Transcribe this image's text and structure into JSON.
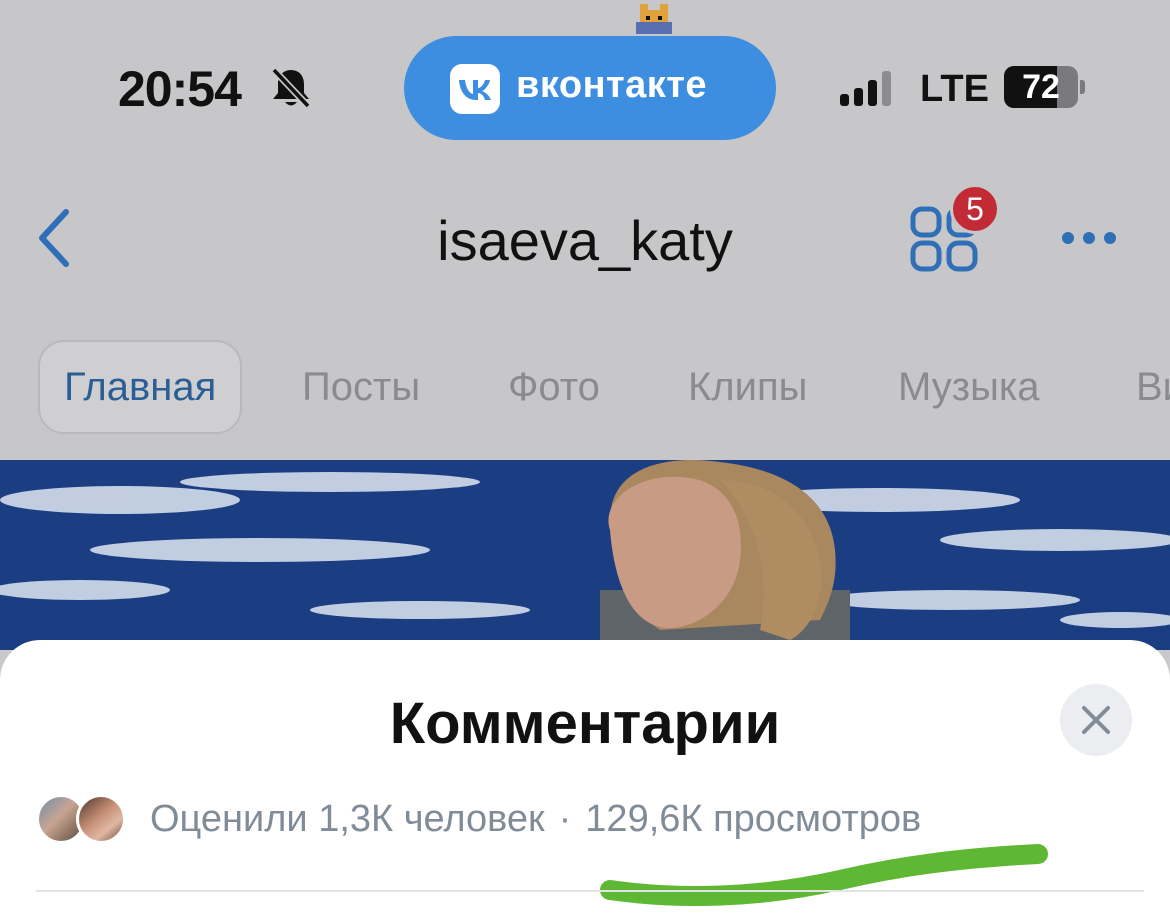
{
  "status_bar": {
    "time": "20:54",
    "network": "LTE",
    "battery": "72",
    "battery_level": 0.72
  },
  "app_pill": {
    "label": "вконтакте"
  },
  "profile": {
    "username": "isaeva_katy",
    "apps_badge": "5"
  },
  "tabs": [
    {
      "label": "Главная",
      "active": true
    },
    {
      "label": "Посты",
      "active": false
    },
    {
      "label": "Фото",
      "active": false
    },
    {
      "label": "Клипы",
      "active": false
    },
    {
      "label": "Музыка",
      "active": false
    },
    {
      "label": "Ви",
      "active": false
    }
  ],
  "comments_sheet": {
    "title": "Комментарии",
    "liked_text": "Оценили 1,3К человек",
    "separator": "·",
    "views_text": "129,6К просмотров"
  },
  "icons": {
    "bell": "bell-muted-icon",
    "back": "chevron-left-icon",
    "apps": "apps-grid-icon",
    "more": "more-horizontal-icon",
    "close": "close-icon"
  },
  "colors": {
    "vk_blue": "#3d8ee0",
    "active_tab": "#2a5e94",
    "badge_red": "#c22a35",
    "secondary_text": "#818c99",
    "highlight_green": "#5fb833"
  }
}
